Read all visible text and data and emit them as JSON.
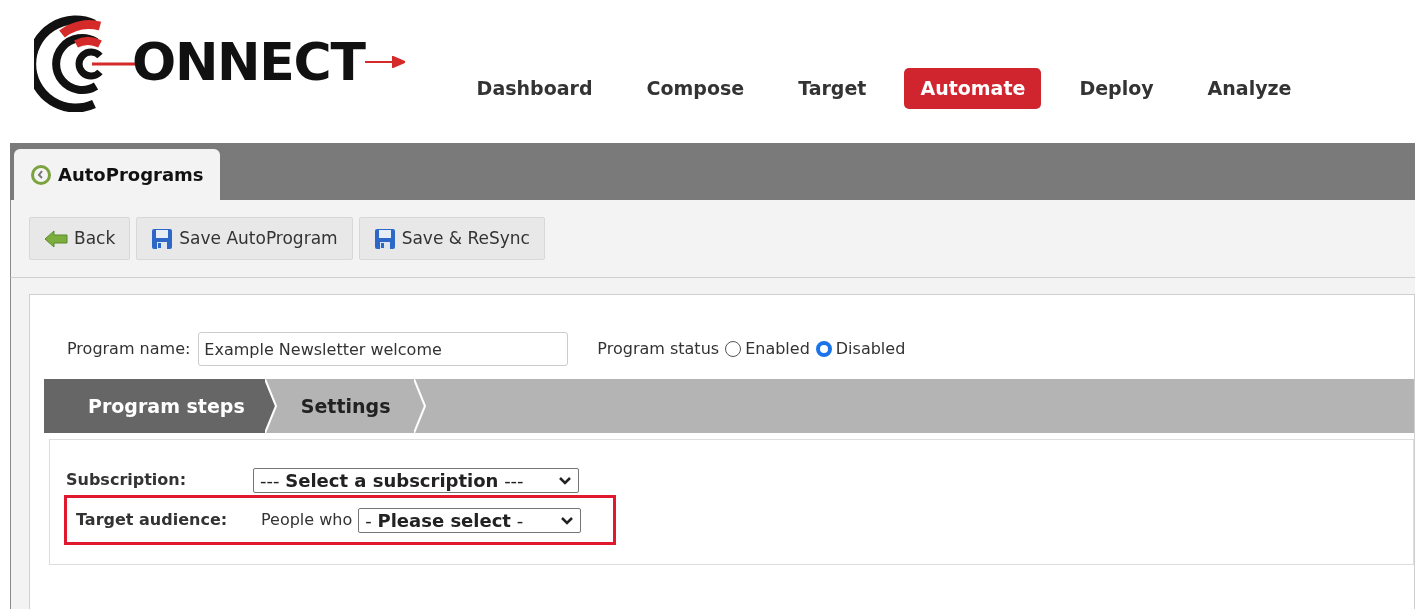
{
  "logo": {
    "text": "ONNECT"
  },
  "nav": [
    {
      "label": "Dashboard",
      "selected": false
    },
    {
      "label": "Compose",
      "selected": false
    },
    {
      "label": "Target",
      "selected": false
    },
    {
      "label": "Automate",
      "selected": true
    },
    {
      "label": "Deploy",
      "selected": false
    },
    {
      "label": "Analyze",
      "selected": false
    }
  ],
  "page_tab": {
    "label": "AutoPrograms"
  },
  "toolbar": [
    {
      "kind": "back",
      "label": "Back"
    },
    {
      "kind": "save",
      "label": "Save AutoProgram"
    },
    {
      "kind": "save",
      "label": "Save & ReSync"
    }
  ],
  "program_name": {
    "label": "Program name:",
    "value": "Example Newsletter welcome"
  },
  "program_status": {
    "label": "Program status",
    "options": [
      {
        "label": "Enabled",
        "selected": false
      },
      {
        "label": "Disabled",
        "selected": true
      }
    ]
  },
  "steps": [
    {
      "label": "Program steps",
      "selected": true
    },
    {
      "label": "Settings",
      "selected": false
    }
  ],
  "subscription": {
    "label": "Subscription:",
    "value": "--- **Select a subscription** ---"
  },
  "target_audience": {
    "label": "Target audience:",
    "prefix": "People who",
    "value": "- **Please select** -",
    "highlighted": true
  }
}
